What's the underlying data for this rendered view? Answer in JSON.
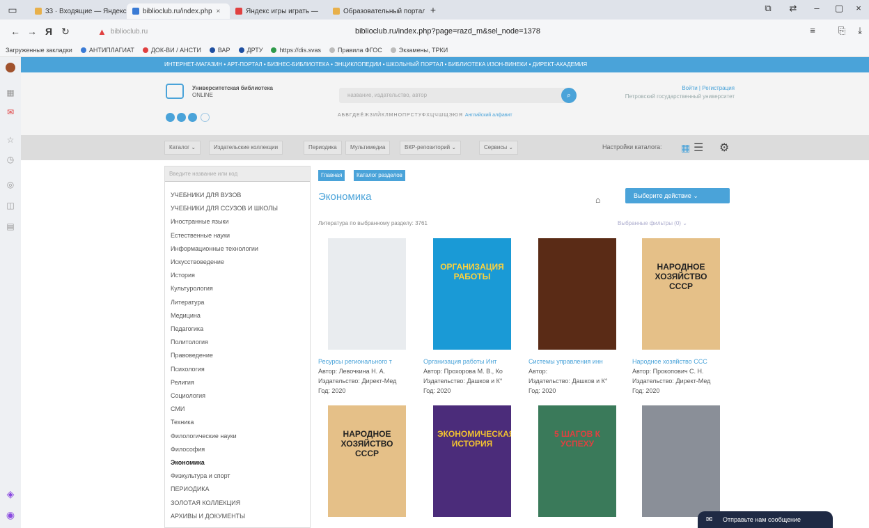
{
  "browser": {
    "tabs": [
      {
        "label": "33 · Входящие — Яндекс",
        "color": "#e8b04a"
      },
      {
        "label": "biblioclub.ru/index.php",
        "color": "#3a7bd5"
      },
      {
        "label": "Яндекс игры играть — ",
        "color": "#e04040"
      },
      {
        "label": "Образовательный портал",
        "color": "#e8b04a"
      }
    ],
    "url_short": "biblioclub.ru",
    "url": "biblioclub.ru/index.php?page=razd_m&sel_node=1378",
    "bookmarks": [
      "Загруженные закладки",
      "АНТИПЛАГИАТ",
      "ДОК-ВИ / АНСТИ",
      "ВАР",
      "ДРТУ",
      "https://dis.svas",
      "Правила ФГОС",
      "Экзамены, ТРКИ"
    ]
  },
  "site": {
    "top_links": "ИНТЕРНЕТ-МАГАЗИН • АРТ-ПОРТАЛ • БИЗНЕС-БИБЛИОТЕКА • ЭНЦИКЛОПЕДИИ • ШКОЛЬНЫЙ ПОРТАЛ • БИБЛИОТЕКА ИЗОН-ВИНЕКИ • ДИРЕКТ-АКАДЕМИЯ",
    "logo_title": "Университетская библиотека",
    "logo_sub": "ONLINE",
    "search_placeholder": "название, издательство, автор",
    "alphabet": "АБВГДЕЁЖЗИЙКЛМНОПРСТУФХЦЧШЩЭЮЯ",
    "alphabet_en": "Английский алфавит",
    "login": "Войти | Регистрация",
    "org": "Петровский государственный университет"
  },
  "menu": {
    "items": [
      "Каталог",
      "Издательские коллекции",
      "Периодика",
      "Мультимедиа",
      "ВКР-репозиторий",
      "Сервисы"
    ],
    "catalog_settings": "Настройки каталога:"
  },
  "categories": {
    "search_placeholder": "Введите название или код",
    "items": [
      "УЧЕБНИКИ ДЛЯ ВУЗОВ",
      "УЧЕБНИКИ ДЛЯ ССУЗОВ И ШКОЛЫ",
      "Иностранные языки",
      "Естественные науки",
      "Информационные технологии",
      "Искусствоведение",
      "История",
      "Культурология",
      "Литература",
      "Медицина",
      "Педагогика",
      "Политология",
      "Правоведение",
      "Психология",
      "Религия",
      "Социология",
      "СМИ",
      "Техника",
      "Филологические науки",
      "Философия",
      "Экономика",
      "Физкультура и спорт",
      "ПЕРИОДИКА",
      "ЗОЛОТАЯ КОЛЛЕКЦИЯ",
      "АРХИВЫ И ДОКУМЕНТЫ"
    ],
    "selected_index": 20
  },
  "main": {
    "crumb_home": "Главная",
    "crumb_catalog": "Каталог разделов",
    "title": "Экономика",
    "action_button": "Выберите действие",
    "lit_count": "Литература по выбранному разделу: 3761",
    "filters": "Выбранные фильтры (0)",
    "author_prefix": "Автор:",
    "publisher_prefix": "Издательство:",
    "year_prefix": "Год:",
    "books": [
      {
        "title": "Ресурсы регионального т",
        "author": "Левочкина Н. А.",
        "publisher": "Директ-Мед",
        "year": "2020",
        "cover_bg": "#e9ecef",
        "cover_title": "",
        "cover_color": "#333"
      },
      {
        "title": "Организация работы Инт",
        "author": "Прохорова М. В., Ко",
        "publisher": "Дашков и К°",
        "year": "2020",
        "cover_bg": "#1a9ad6",
        "cover_title": "ОРГАНИЗАЦИЯ РАБОТЫ",
        "cover_color": "#ffd23a"
      },
      {
        "title": "Системы управления инн",
        "author": "",
        "publisher": "Дашков и К°",
        "year": "2020",
        "cover_bg": "#5a2b16",
        "cover_title": "",
        "cover_color": "#eee"
      },
      {
        "title": "Народное хозяйство ССС",
        "author": "Прокопович С. Н.",
        "publisher": "Директ-Мед",
        "year": "2020",
        "cover_bg": "#e5c088",
        "cover_title": "НАРОДНОЕ ХОЗЯЙСТВО СССР",
        "cover_color": "#222"
      },
      {
        "title": "",
        "author": "",
        "publisher": "",
        "year": "",
        "cover_bg": "#e5c088",
        "cover_title": "НАРОДНОЕ ХОЗЯЙСТВО СССР",
        "cover_color": "#222"
      },
      {
        "title": "",
        "author": "",
        "publisher": "",
        "year": "",
        "cover_bg": "#4b2c7a",
        "cover_title": "ЭКОНОМИЧЕСКАЯ ИСТОРИЯ",
        "cover_color": "#f2c230"
      },
      {
        "title": "",
        "author": "",
        "publisher": "",
        "year": "",
        "cover_bg": "#3a7a5a",
        "cover_title": "5 ШАГОВ К УСПЕХУ",
        "cover_color": "#e04040"
      },
      {
        "title": "",
        "author": "",
        "publisher": "",
        "year": "",
        "cover_bg": "#8a8f98",
        "cover_title": "",
        "cover_color": "#fff"
      }
    ]
  },
  "chat": {
    "label": "Отправьте нам сообщение"
  },
  "colors": {
    "accent": "#4aa3d9",
    "chat_bg": "#1f2a44"
  }
}
